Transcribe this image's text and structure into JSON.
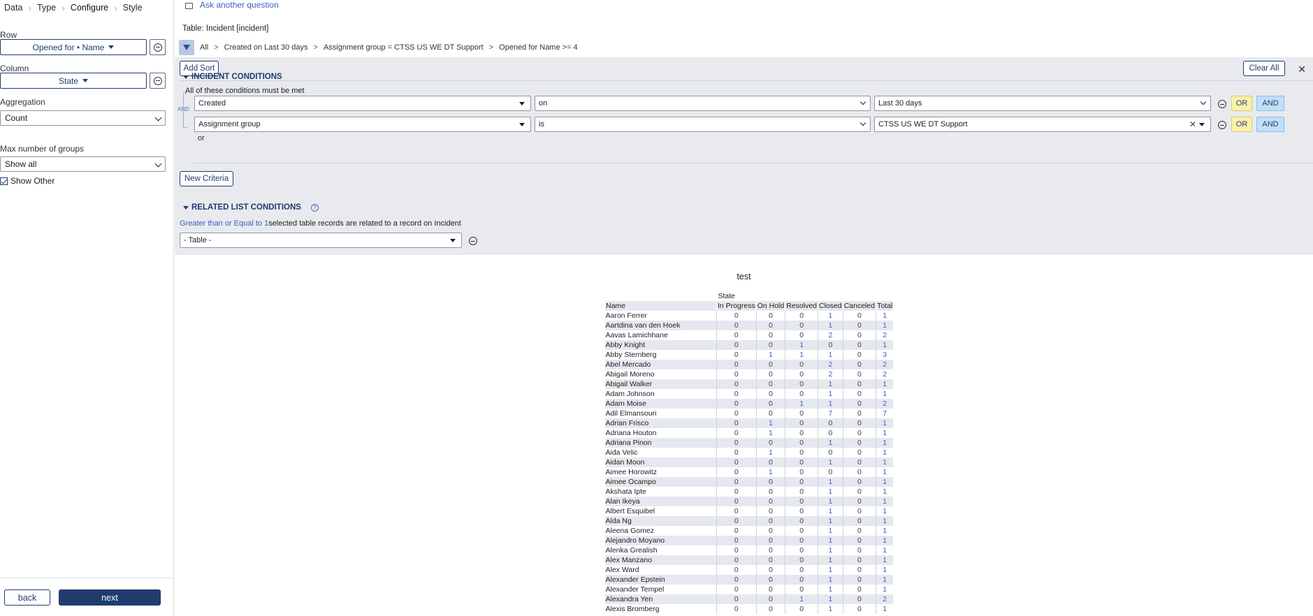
{
  "steps": [
    "Data",
    "Type",
    "Configure",
    "Style"
  ],
  "left": {
    "row_label": "Row",
    "row_value": "Opened for • Name",
    "column_label": "Column",
    "column_value": "State",
    "aggregation_label": "Aggregation",
    "aggregation_value": "Count",
    "max_groups_label": "Max number of groups",
    "max_groups_value": "Show all",
    "show_other_label": "Show Other",
    "back_label": "back",
    "next_label": "next"
  },
  "header": {
    "ask_label": "Ask another question",
    "table_title": "Table: Incident [incident]",
    "breadcrumbs": [
      "All",
      "Created on Last 30 days",
      "Assignment group = CTSS US WE DT Support",
      "Opened for Name >= 4"
    ]
  },
  "conditions": {
    "add_sort": "Add Sort",
    "clear_all": "Clear All",
    "incident_title": "Incident Conditions",
    "all_met": "All of these conditions must be met",
    "and_label": "AND",
    "rows": [
      {
        "field": "Created",
        "operator": "on",
        "value": "Last 30 days"
      },
      {
        "field": "Assignment group",
        "operator": "is",
        "value": "CTSS US WE DT Support"
      }
    ],
    "or_btn": "OR",
    "and_btn": "AND",
    "or_label": "or",
    "new_criteria": "New Criteria",
    "related_title": "Related List Conditions",
    "related_link": "Greater than or Equal to 1",
    "related_text": "selected table records are related to a record on Incident",
    "table_select": "- Table -"
  },
  "report": {
    "title": "test",
    "state_header": "State",
    "name_header": "Name",
    "columns": [
      "In Progress",
      "On Hold",
      "Resolved",
      "Closed",
      "Canceled",
      "Total"
    ],
    "rows": [
      [
        "Aaron Ferrer",
        0,
        0,
        0,
        1,
        0,
        1
      ],
      [
        "Aartdina van den Hoek",
        0,
        0,
        0,
        1,
        0,
        1
      ],
      [
        "Aavas Lamichhane",
        0,
        0,
        0,
        2,
        0,
        2
      ],
      [
        "Abby Knight",
        0,
        0,
        1,
        0,
        0,
        1
      ],
      [
        "Abby Sternberg",
        0,
        1,
        1,
        1,
        0,
        3
      ],
      [
        "Abel Mercado",
        0,
        0,
        0,
        2,
        0,
        2
      ],
      [
        "Abigail Moreno",
        0,
        0,
        0,
        2,
        0,
        2
      ],
      [
        "Abigail Walker",
        0,
        0,
        0,
        1,
        0,
        1
      ],
      [
        "Adam Johnson",
        0,
        0,
        0,
        1,
        0,
        1
      ],
      [
        "Adam Moise",
        0,
        0,
        1,
        1,
        0,
        2
      ],
      [
        "Adil Elmansouri",
        0,
        0,
        0,
        7,
        0,
        7
      ],
      [
        "Adrian Frisco",
        0,
        1,
        0,
        0,
        0,
        1
      ],
      [
        "Adriana Houton",
        0,
        1,
        0,
        0,
        0,
        1
      ],
      [
        "Adriana Pinon",
        0,
        0,
        0,
        1,
        0,
        1
      ],
      [
        "Aida Velic",
        0,
        1,
        0,
        0,
        0,
        1
      ],
      [
        "Aidan Moon",
        0,
        0,
        0,
        1,
        0,
        1
      ],
      [
        "Aimee Horowitz",
        0,
        1,
        0,
        0,
        0,
        1
      ],
      [
        "Aimee Ocampo",
        0,
        0,
        0,
        1,
        0,
        1
      ],
      [
        "Akshata Ipte",
        0,
        0,
        0,
        1,
        0,
        1
      ],
      [
        "Alan Ikeya",
        0,
        0,
        0,
        1,
        0,
        1
      ],
      [
        "Albert Esquibel",
        0,
        0,
        0,
        1,
        0,
        1
      ],
      [
        "Alda Ng",
        0,
        0,
        0,
        1,
        0,
        1
      ],
      [
        "Aleena Gomez",
        0,
        0,
        0,
        1,
        0,
        1
      ],
      [
        "Alejandro Moyano",
        0,
        0,
        0,
        1,
        0,
        1
      ],
      [
        "Alenka Grealish",
        0,
        0,
        0,
        1,
        0,
        1
      ],
      [
        "Alex Manzano",
        0,
        0,
        0,
        1,
        0,
        1
      ],
      [
        "Alex Ward",
        0,
        0,
        0,
        1,
        0,
        1
      ],
      [
        "Alexander Epstein",
        0,
        0,
        0,
        1,
        0,
        1
      ],
      [
        "Alexander Tempel",
        0,
        0,
        0,
        1,
        0,
        1
      ],
      [
        "Alexandra Yen",
        0,
        0,
        1,
        1,
        0,
        2
      ],
      [
        "Alexis Bromberg",
        0,
        0,
        0,
        1,
        0,
        1
      ]
    ]
  },
  "colors": {
    "primary": "#1f3c6e",
    "link": "#3b5ec7",
    "panel": "#e8eaee",
    "or": "#fbf1a9",
    "and": "#bfe0f8"
  }
}
